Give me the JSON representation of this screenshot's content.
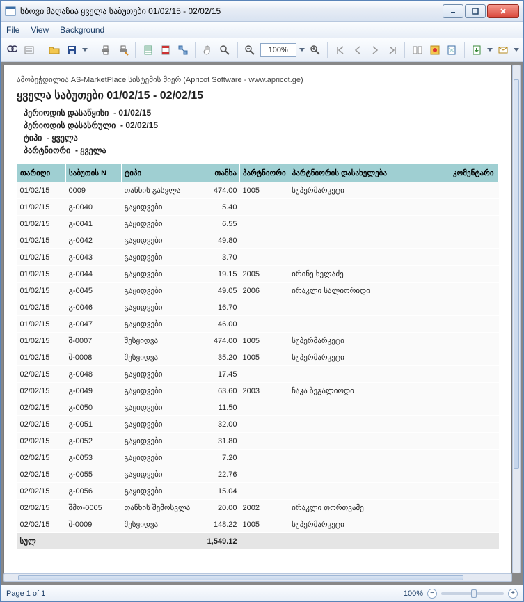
{
  "window": {
    "title": "სბოვი მაღაზია ყველა საბუთები 01/02/15 - 02/02/15"
  },
  "menu": {
    "file": "File",
    "view": "View",
    "background": "Background"
  },
  "toolbar": {
    "zoom_value": "100%"
  },
  "report": {
    "header_line": "ამობეჭდილია AS-MarketPlace სისტემის მიერ (Apricot Software - www.apricot.ge)",
    "title": "ყველა საბუთები 01/02/15 - 02/02/15",
    "params": {
      "period_start_label": "პერიოდის დასაწყისი",
      "period_start_value": "- 01/02/15",
      "period_end_label": "პერიოდის დასასრული",
      "period_end_value": "- 02/02/15",
      "type_label": "ტიპი",
      "type_value": "- ყველა",
      "partner_label": "პარტნიორი",
      "partner_value": "- ყველა"
    },
    "columns": {
      "date": "თარიღი",
      "docno": "საბუთის N",
      "type": "ტიპი",
      "amount": "თანხა",
      "partner": "პარტნიორი",
      "partner_name": "პარტნიორის დასახელება",
      "comment": "კომენტარი"
    },
    "rows": [
      {
        "date": "01/02/15",
        "docno": "0009",
        "type": "თანხის გასვლა",
        "amount": "474.00",
        "partner": "1005",
        "partner_name": "სუპერმარკეტი",
        "comment": ""
      },
      {
        "date": "01/02/15",
        "docno": "გ-0040",
        "type": "გაყიდვები",
        "amount": "5.40",
        "partner": "",
        "partner_name": "",
        "comment": ""
      },
      {
        "date": "01/02/15",
        "docno": "გ-0041",
        "type": "გაყიდვები",
        "amount": "6.55",
        "partner": "",
        "partner_name": "",
        "comment": ""
      },
      {
        "date": "01/02/15",
        "docno": "გ-0042",
        "type": "გაყიდვები",
        "amount": "49.80",
        "partner": "",
        "partner_name": "",
        "comment": ""
      },
      {
        "date": "01/02/15",
        "docno": "გ-0043",
        "type": "გაყიდვები",
        "amount": "3.70",
        "partner": "",
        "partner_name": "",
        "comment": ""
      },
      {
        "date": "01/02/15",
        "docno": "გ-0044",
        "type": "გაყიდვები",
        "amount": "19.15",
        "partner": "2005",
        "partner_name": "ირინე ხელაძე",
        "comment": ""
      },
      {
        "date": "01/02/15",
        "docno": "გ-0045",
        "type": "გაყიდვები",
        "amount": "49.05",
        "partner": "2006",
        "partner_name": "ირაკლი სალიორიდი",
        "comment": ""
      },
      {
        "date": "01/02/15",
        "docno": "გ-0046",
        "type": "გაყიდვები",
        "amount": "16.70",
        "partner": "",
        "partner_name": "",
        "comment": ""
      },
      {
        "date": "01/02/15",
        "docno": "გ-0047",
        "type": "გაყიდვები",
        "amount": "46.00",
        "partner": "",
        "partner_name": "",
        "comment": ""
      },
      {
        "date": "01/02/15",
        "docno": "შ-0007",
        "type": "შესყიდვა",
        "amount": "474.00",
        "partner": "1005",
        "partner_name": "სუპერმარკეტი",
        "comment": ""
      },
      {
        "date": "01/02/15",
        "docno": "შ-0008",
        "type": "შესყიდვა",
        "amount": "35.20",
        "partner": "1005",
        "partner_name": "სუპერმარკეტი",
        "comment": ""
      },
      {
        "date": "02/02/15",
        "docno": "გ-0048",
        "type": "გაყიდვები",
        "amount": "17.45",
        "partner": "",
        "partner_name": "",
        "comment": ""
      },
      {
        "date": "02/02/15",
        "docno": "გ-0049",
        "type": "გაყიდვები",
        "amount": "63.60",
        "partner": "2003",
        "partner_name": "ჩაკა ბეგალიოდი",
        "comment": ""
      },
      {
        "date": "02/02/15",
        "docno": "გ-0050",
        "type": "გაყიდვები",
        "amount": "11.50",
        "partner": "",
        "partner_name": "",
        "comment": ""
      },
      {
        "date": "02/02/15",
        "docno": "გ-0051",
        "type": "გაყიდვები",
        "amount": "32.00",
        "partner": "",
        "partner_name": "",
        "comment": ""
      },
      {
        "date": "02/02/15",
        "docno": "გ-0052",
        "type": "გაყიდვები",
        "amount": "31.80",
        "partner": "",
        "partner_name": "",
        "comment": ""
      },
      {
        "date": "02/02/15",
        "docno": "გ-0053",
        "type": "გაყიდვები",
        "amount": "7.20",
        "partner": "",
        "partner_name": "",
        "comment": ""
      },
      {
        "date": "02/02/15",
        "docno": "გ-0055",
        "type": "გაყიდვები",
        "amount": "22.76",
        "partner": "",
        "partner_name": "",
        "comment": ""
      },
      {
        "date": "02/02/15",
        "docno": "გ-0056",
        "type": "გაყიდვები",
        "amount": "15.04",
        "partner": "",
        "partner_name": "",
        "comment": ""
      },
      {
        "date": "02/02/15",
        "docno": "შმო-0005",
        "type": "თანხის შემოსვლა",
        "amount": "20.00",
        "partner": "2002",
        "partner_name": "ირაკლი თორთვამე",
        "comment": ""
      },
      {
        "date": "02/02/15",
        "docno": "შ-0009",
        "type": "შესყიდვა",
        "amount": "148.22",
        "partner": "1005",
        "partner_name": "სუპერმარკეტი",
        "comment": ""
      }
    ],
    "total_label": "სულ",
    "total_amount": "1,549.12"
  },
  "status": {
    "page": "Page 1 of 1",
    "zoom": "100%"
  }
}
